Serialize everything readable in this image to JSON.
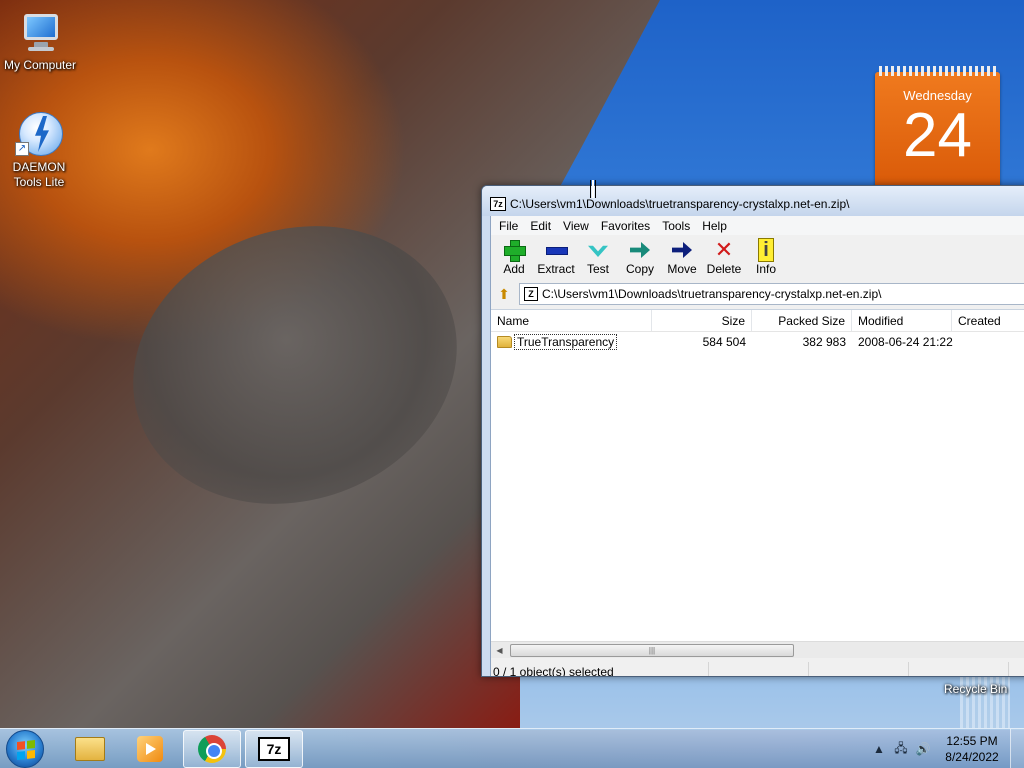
{
  "desktop": {
    "icons": [
      {
        "label": "My Computer",
        "icon": "computer-icon"
      },
      {
        "label": "DAEMON Tools Lite",
        "icon": "daemon-tools-icon"
      }
    ],
    "recycle_bin_label": "Recycle Bin"
  },
  "calendar": {
    "weekday": "Wednesday",
    "day": "24",
    "color": "#e8660f"
  },
  "window": {
    "title": "C:\\Users\\vm1\\Downloads\\truetransparency-crystalxp.net-en.zip\\",
    "app_icon": "7z",
    "menu": [
      "File",
      "Edit",
      "View",
      "Favorites",
      "Tools",
      "Help"
    ],
    "toolbar": [
      {
        "label": "Add",
        "icon": "add-icon"
      },
      {
        "label": "Extract",
        "icon": "extract-icon"
      },
      {
        "label": "Test",
        "icon": "test-icon"
      },
      {
        "label": "Copy",
        "icon": "copy-icon"
      },
      {
        "label": "Move",
        "icon": "move-icon"
      },
      {
        "label": "Delete",
        "icon": "delete-icon"
      },
      {
        "label": "Info",
        "icon": "info-icon"
      }
    ],
    "address": "C:\\Users\\vm1\\Downloads\\truetransparency-crystalxp.net-en.zip\\",
    "columns": [
      "Name",
      "Size",
      "Packed Size",
      "Modified",
      "Created"
    ],
    "rows": [
      {
        "name": "TrueTransparency",
        "size": "584 504",
        "packed_size": "382 983",
        "modified": "2008-06-24 21:22",
        "created": ""
      }
    ],
    "status": "0 / 1 object(s) selected"
  },
  "taskbar": {
    "apps": [
      "start-button",
      "windows-explorer",
      "media-player",
      "google-chrome",
      "7-zip"
    ],
    "time": "12:55 PM",
    "date": "8/24/2022"
  }
}
